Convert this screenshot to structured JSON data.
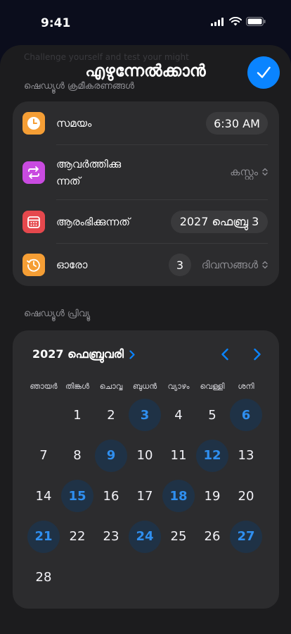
{
  "status": {
    "time": "9:41"
  },
  "sheet": {
    "ghost_text": "Challenge yourself and test your might",
    "title": "എഴുന്നേൽക്കാൻ"
  },
  "sections": {
    "schedule_settings": "ഷെഡ്യൂൾ ക്രമീകരണങ്ങൾ",
    "schedule_preview": "ഷെഡ്യൂൾ പ്രിവ്യൂ"
  },
  "settings": {
    "time_label": "സമയം",
    "time_value": "6:30 AM",
    "repeat_label_line1": "ആവർത്തിക്കു",
    "repeat_label_line2": "ന്നത്",
    "repeat_value": "കസ്റ്റം",
    "start_label": "ആരംഭിക്കുന്നത്",
    "start_value": "2027 ഫെബ്രു 3",
    "every_label": "ഓരോ",
    "every_count": "3",
    "every_unit": "ദിവസങ്ങൾ"
  },
  "calendar": {
    "month_label": "2027 ഫെബ്രുവരി",
    "weekdays": [
      "ഞായർ",
      "തിങ്കൾ",
      "ചൊവ്വ",
      "ബുധൻ",
      "വ്യാഴം",
      "വെള്ളി",
      "ശനി"
    ],
    "first_weekday_index": 1,
    "days_in_month": 28,
    "selected_days": [
      3,
      6,
      9,
      12,
      15,
      18,
      21,
      24,
      27
    ]
  },
  "colors": {
    "accent": "#0a84ff",
    "selected_day_bg": "#1f3246",
    "selected_day_text": "#2f8ff0",
    "clock_icon_bg": "#f59e35",
    "repeat_icon_bg": "#c94be0",
    "calendar_icon_bg": "#e5484d",
    "history_icon_bg": "#f59e35"
  }
}
